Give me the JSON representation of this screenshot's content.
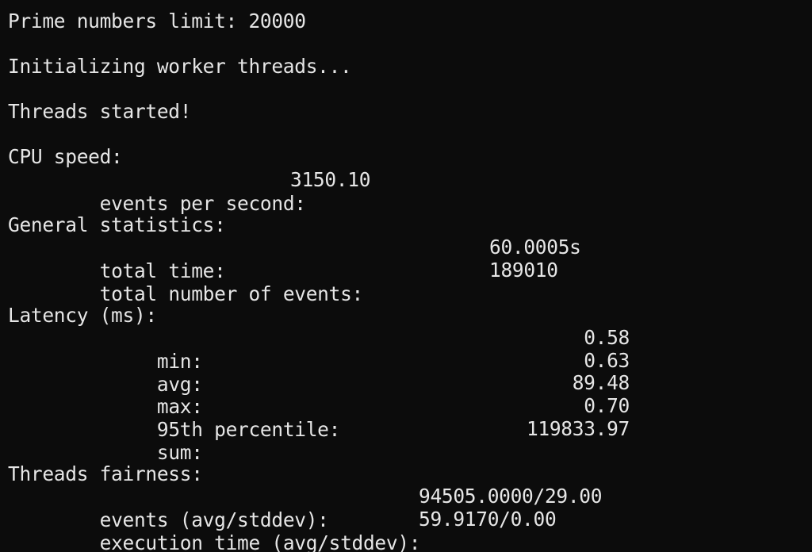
{
  "terminal": {
    "prime_limit": "Prime numbers limit: 20000",
    "init": "Initializing worker threads...",
    "started": "Threads started!",
    "cpu_header": "CPU speed:",
    "eps_label": "    events per second:",
    "eps_value": "3150.10",
    "general_header": "General statistics:",
    "total_time_label": "    total time:",
    "total_time_value": "60.0005s",
    "total_events_label": "    total number of events:",
    "total_events_value": "189010",
    "latency_header": "Latency (ms):",
    "lat_min_label": "         min:",
    "lat_min_value": "0.58",
    "lat_avg_label": "         avg:",
    "lat_avg_value": "0.63",
    "lat_max_label": "         max:",
    "lat_max_value": "89.48",
    "lat_p95_label": "         95th percentile:",
    "lat_p95_value": "0.70",
    "lat_sum_label": "         sum:",
    "lat_sum_value": "119833.97",
    "fairness_header": "Threads fairness:",
    "fair_events_label": "    events (avg/stddev):",
    "fair_events_value": "94505.0000/29.00",
    "fair_exec_label": "    execution time (avg/stddev):",
    "fair_exec_value": "59.9170/0.00"
  }
}
